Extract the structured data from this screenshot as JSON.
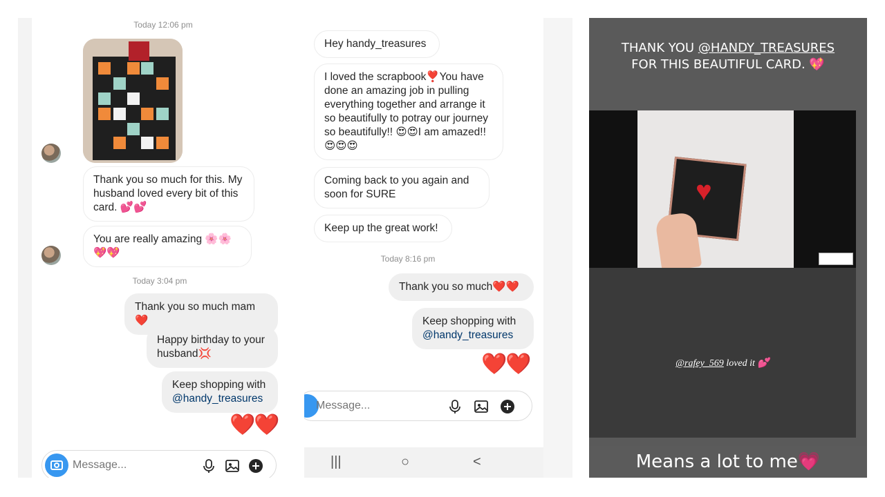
{
  "panel1": {
    "timestamp1": "Today 12:06 pm",
    "msg1": "Thank you so much for this. My husband loved every bit of this card. 💕💕",
    "msg2": "You are really amazing 🌸🌸💖💖",
    "timestamp2": "Today 3:04 pm",
    "msg3": "Thank you so much mam❤️",
    "msg4": "Happy birthday to your husband💢",
    "msg5_line1": "Keep shopping with",
    "msg5_mention": "@handy_treasures",
    "hearts": "❤️❤️",
    "composer_placeholder": "Message..."
  },
  "panel2": {
    "msg1": "Hey handy_treasures",
    "msg2": "I loved the scrapbook❣️You have done an amazing job in pulling everything together and arrange it so beautifully to potray our journey so beautifully!! 😍😍I am amazed!! 😍😍😍",
    "msg3": "Coming back to you again and soon for SURE",
    "msg4": "Keep up the great work!",
    "timestamp": "Today 8:16 pm",
    "msg5": "Thank you so much❤️❤️",
    "msg6_line1": "Keep shopping with",
    "msg6_mention": "@handy_treasures",
    "hearts": "❤️❤️",
    "composer_placeholder": "Message...",
    "nav_recents": "|||",
    "nav_home": "○",
    "nav_back": "<"
  },
  "panel3": {
    "story_line1_prefix": "THANK YOU ",
    "story_mention": "@HANDY_TREASURES",
    "story_line2": "FOR THIS BEAUTIFUL CARD. 💖",
    "repost_mention": "@rafey_569",
    "repost_text": " loved it 💕",
    "caption": "Means a lot to me💗"
  },
  "colors": {
    "link": "#00376b",
    "camera_button": "#3797f0",
    "heart": "#e02424"
  }
}
